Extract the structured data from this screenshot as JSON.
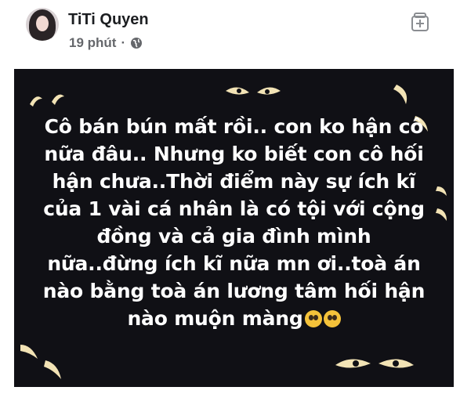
{
  "post": {
    "author_name": "TiTi Quyen",
    "time_ago": "19 phút",
    "separator": "·",
    "privacy_icon": "globe-icon",
    "action_icon": "add-to-collection-icon",
    "text_lines": [
      "Cô bán bún mất rồi.. con ko hận cô",
      "nữa đâu.. Nhưng ko biết con cô hối",
      "hận chưa..Thời điểm này sự ích kĩ",
      "của 1 vài cá nhân là có tội với cộng",
      "đồng và cả gia đình mình",
      "nữa..đừng ích kĩ nữa mn ơi..toà án",
      "nào bằng toà án lương tâm hối hận",
      "nào muộn màng"
    ],
    "trailing_emoji": "pleading-face-emoji",
    "colors": {
      "background": "#101015",
      "text": "#ffffff",
      "eyes": "#f2e3b5"
    }
  }
}
